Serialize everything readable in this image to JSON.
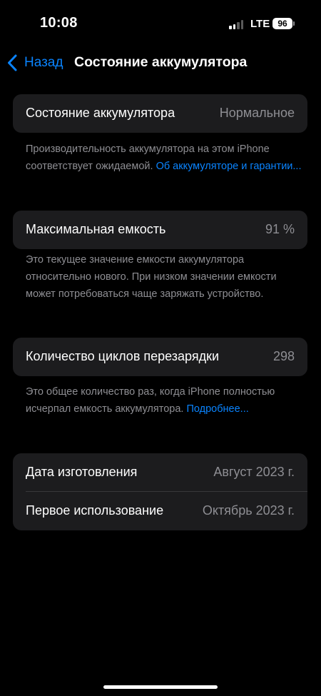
{
  "status_bar": {
    "time": "10:08",
    "network": "LTE",
    "battery_level": "96",
    "signal_bars_active": 2,
    "signal_bars_total": 4
  },
  "nav": {
    "back_label": "Назад",
    "title": "Состояние аккумулятора"
  },
  "battery_health": {
    "label": "Состояние аккумулятора",
    "value": "Нормальное",
    "footnote_text": "Производительность аккумулятора на этом iPhone соответствует ожидаемой. ",
    "footnote_link": "Об аккумуляторе и гарантии..."
  },
  "max_capacity": {
    "label": "Максимальная емкость",
    "value": "91 %",
    "footnote": "Это текущее значение емкости аккумулятора относительно нового. При низком значении емкости может потребоваться чаще заряжать устройство."
  },
  "cycle_count": {
    "label": "Количество циклов перезарядки",
    "value": "298",
    "footnote_text": "Это общее количество раз, когда iPhone полностью исчерпал емкость аккумулятора. ",
    "footnote_link": "Подробнее..."
  },
  "dates": {
    "manufacture_label": "Дата изготовления",
    "manufacture_value": "Август 2023 г.",
    "first_use_label": "Первое использование",
    "first_use_value": "Октябрь 2023 г."
  },
  "colors": {
    "background": "#000000",
    "card": "#1c1c1e",
    "accent": "#0a84ff",
    "secondary_text": "#8e8e93"
  }
}
